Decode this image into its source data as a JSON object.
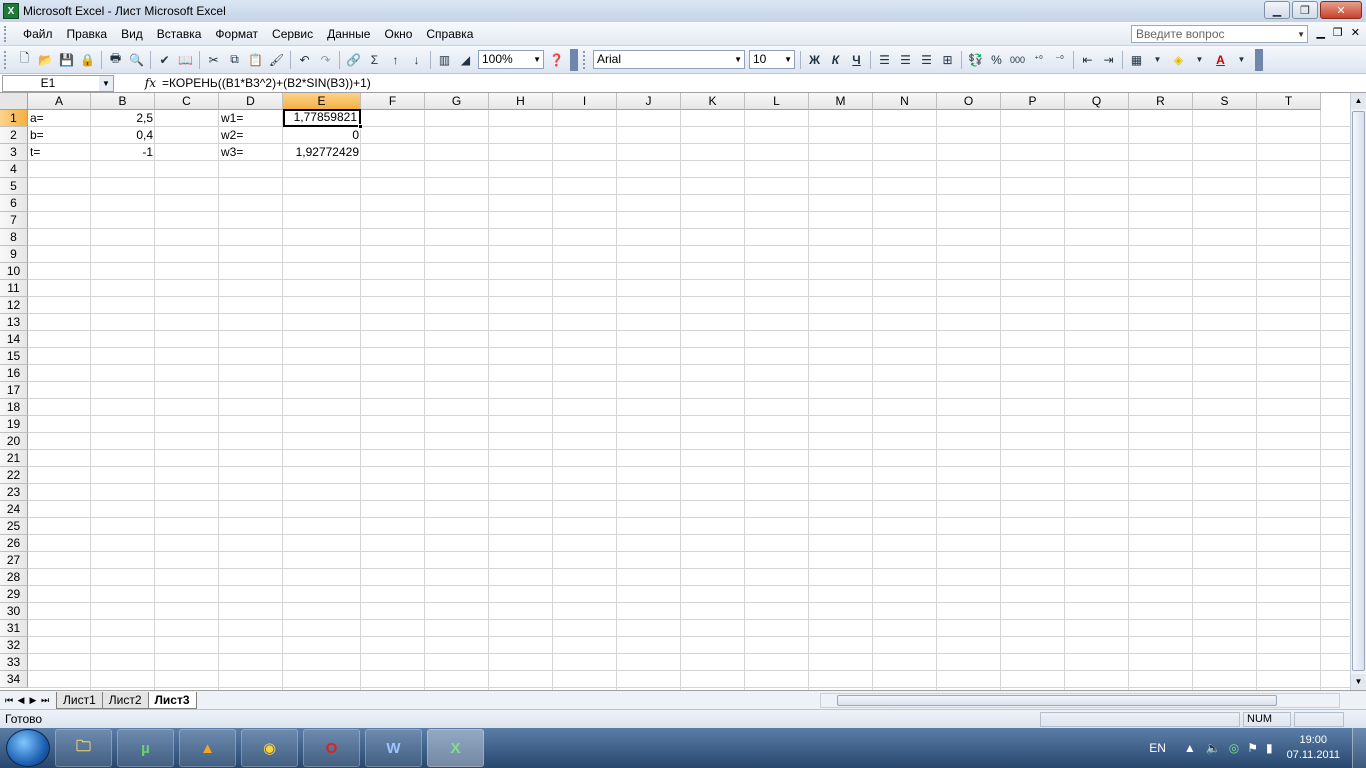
{
  "window": {
    "title": "Microsoft Excel - Лист Microsoft Excel",
    "app_icon": "X"
  },
  "menu": {
    "items": [
      "Файл",
      "Правка",
      "Вид",
      "Вставка",
      "Формат",
      "Сервис",
      "Данные",
      "Окно",
      "Справка"
    ],
    "help_placeholder": "Введите вопрос"
  },
  "toolbar": {
    "zoom": "100%",
    "font": "Arial",
    "font_size": "10",
    "bold": "Ж",
    "italic": "К",
    "underline": "Ч"
  },
  "formula_bar": {
    "name_box": "E1",
    "fx_label": "fx",
    "formula": "=КОРЕНЬ((B1*B3^2)+(B2*SIN(B3))+1)"
  },
  "sheet": {
    "columns": [
      "A",
      "B",
      "C",
      "D",
      "E",
      "F",
      "G",
      "H",
      "I",
      "J",
      "K",
      "L",
      "M",
      "N",
      "O",
      "P",
      "Q",
      "R",
      "S",
      "T"
    ],
    "rows": [
      "1",
      "2",
      "3",
      "4",
      "5",
      "6",
      "7",
      "8",
      "9",
      "10",
      "11",
      "12",
      "13",
      "14",
      "15",
      "16",
      "17",
      "18",
      "19",
      "20",
      "21",
      "22",
      "23",
      "24",
      "25",
      "26",
      "27",
      "28",
      "29",
      "30",
      "31",
      "32",
      "33",
      "34"
    ],
    "selected_column": "E",
    "selected_row": "1",
    "cells": {
      "A1": "a=",
      "B1": "2,5",
      "D1": "w1=",
      "E1": "1,77859821",
      "A2": "b=",
      "B2": "0,4",
      "D2": "w2=",
      "E2": "0",
      "A3": "t=",
      "B3": "-1",
      "D3": "w3=",
      "E3": "1,92772429"
    }
  },
  "tabs": {
    "sheets": [
      "Лист1",
      "Лист2",
      "Лист3"
    ],
    "active": "Лист3"
  },
  "status": {
    "text": "Готово",
    "num": "NUM"
  },
  "taskbar": {
    "lang": "EN",
    "time": "19:00",
    "date": "07.11.2011",
    "apps": [
      "folder-icon",
      "utorrent-icon",
      "aimp-icon",
      "chrome-icon",
      "opera-icon",
      "word-icon",
      "excel-icon"
    ]
  }
}
